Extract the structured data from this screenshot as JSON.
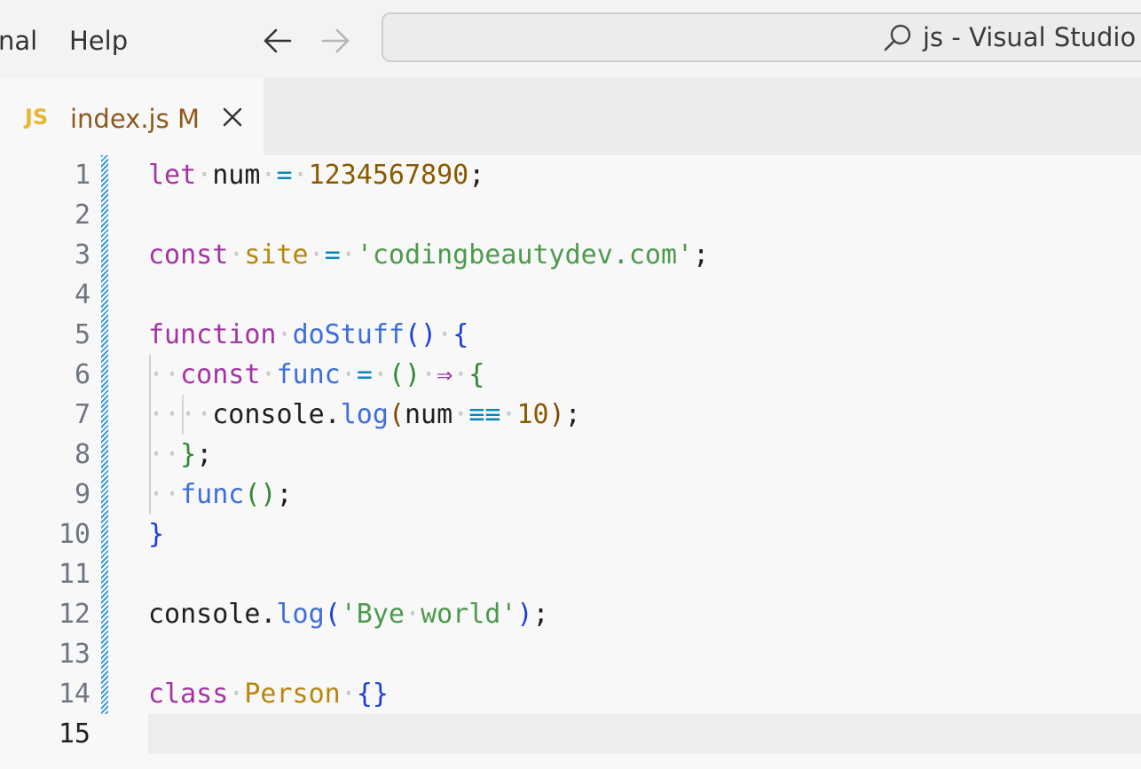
{
  "menu": {
    "items": [
      "nal",
      "Help"
    ]
  },
  "navigation": {
    "back_icon": "arrow-left-icon",
    "forward_icon": "arrow-right-icon"
  },
  "command_center": {
    "search_icon": "search-icon",
    "text": "js - Visual Studio C"
  },
  "tab": {
    "language_badge": "JS",
    "filename": "index.js",
    "status": "M",
    "close_icon": "close-icon"
  },
  "colors": {
    "keyword": "#a334a3",
    "number": "#8a5a00",
    "string": "#4c9a4c",
    "function": "#3d6fd6",
    "operator": "#0b86b8",
    "class": "#b8860b",
    "gutter_modified": "#3d9ad6"
  },
  "editor": {
    "active_line": 15,
    "line_numbers": [
      "1",
      "2",
      "3",
      "4",
      "5",
      "6",
      "7",
      "8",
      "9",
      "10",
      "11",
      "12",
      "13",
      "14",
      "15"
    ],
    "lines": [
      "let num = 1234567890;",
      "",
      "const site = 'codingbeautydev.com';",
      "",
      "function doStuff() {",
      "  const func = () => {",
      "    console.log(num === 10);",
      "  };",
      "  func();",
      "}",
      "",
      "console.log('Bye world');",
      "",
      "class Person {}",
      ""
    ]
  }
}
